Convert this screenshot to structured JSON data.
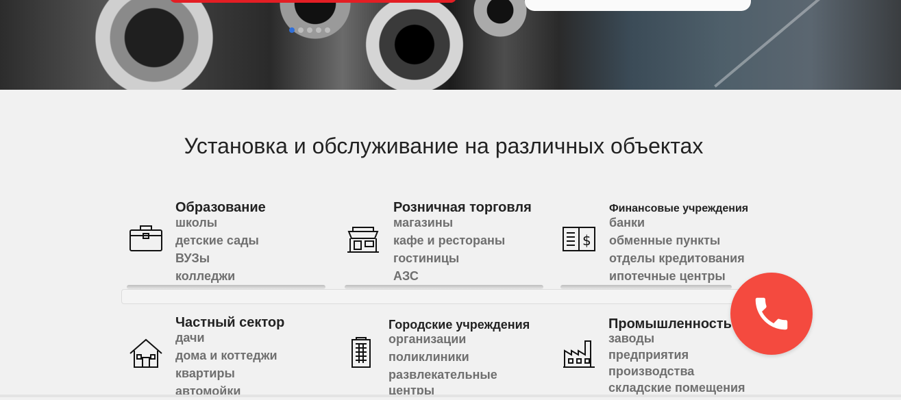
{
  "hero": {
    "slider_dots": [
      {
        "active": true
      },
      {
        "active": false
      },
      {
        "active": false
      },
      {
        "active": false
      },
      {
        "active": false
      }
    ]
  },
  "section": {
    "title": "Установка и обслуживание на различных объектах"
  },
  "categories": [
    {
      "icon": "briefcase-icon",
      "title": "Образование",
      "items": [
        "школы",
        "детские сады",
        "ВУЗы",
        "колледжи"
      ]
    },
    {
      "icon": "shop-icon",
      "title": "Розничная торговля",
      "items": [
        "магазины",
        "кафе и рестораны",
        "гостиницы",
        "АЗС"
      ]
    },
    {
      "icon": "finance-icon",
      "title": "Финансовые учреждения",
      "items": [
        "банки",
        "обменные пункты",
        "отделы кредитования",
        "ипотечные центры"
      ]
    },
    {
      "icon": "house-icon",
      "title": "Частный сектор",
      "items": [
        "дачи",
        "дома и коттеджи",
        "квартиры",
        "автомойки"
      ]
    },
    {
      "icon": "building-icon",
      "title": "Городские учреждения",
      "items": [
        "организации",
        "поликлиники",
        "развлекательные",
        "центры"
      ]
    },
    {
      "icon": "factory-icon",
      "title": "Промышленность",
      "items": [
        "заводы",
        "предприятия",
        "производства",
        "складские помещения"
      ]
    }
  ],
  "call_button": {
    "icon": "phone-icon"
  },
  "colors": {
    "accent": "#e31e24",
    "call": "#f44a3f",
    "active_dot": "#2f6fd9"
  }
}
